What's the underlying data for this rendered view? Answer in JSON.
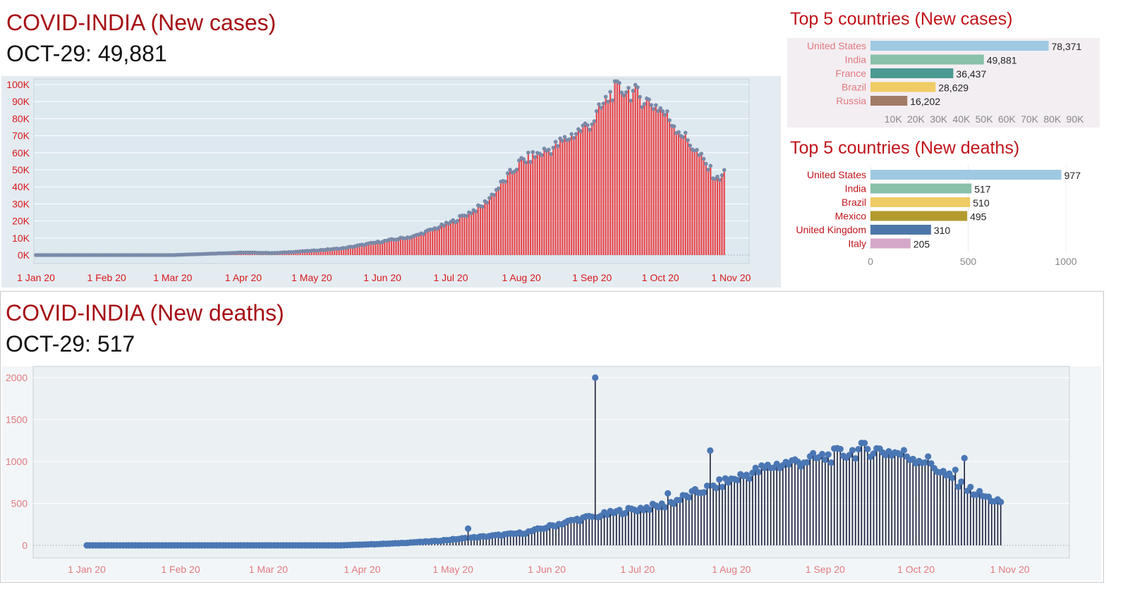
{
  "cases_panel": {
    "title": "COVID-INDIA (New cases)",
    "subtitle": "OCT-29: 49,881"
  },
  "deaths_panel": {
    "title": "COVID-INDIA (New deaths)",
    "subtitle": "OCT-29: 517"
  },
  "top_cases": {
    "title": "Top 5 countries  (New cases)"
  },
  "top_deaths": {
    "title": "Top 5 countries  (New deaths)"
  },
  "colors": {
    "cases_bar": "#e8474c",
    "cases_dot": "#7a8aa8",
    "cases_axis_text": "#d7191c",
    "cases_plot_bg": "#dde8ef",
    "deaths_stem": "#1b1f3b",
    "deaths_dot": "#4a77b4",
    "deaths_axis_text": "#e07a80",
    "deaths_plot_bg": "#ebf0f3"
  },
  "chart_data": [
    {
      "id": "india-new-cases",
      "type": "bar",
      "title": "COVID-INDIA (New cases)",
      "x_start": "2020-01-01",
      "x_end": "2020-10-29",
      "ylim": [
        0,
        100000
      ],
      "y_ticks": [
        0,
        10000,
        20000,
        30000,
        40000,
        50000,
        60000,
        70000,
        80000,
        90000,
        100000
      ],
      "y_tick_labels": [
        "0K",
        "10K",
        "20K",
        "30K",
        "40K",
        "50K",
        "60K",
        "70K",
        "80K",
        "90K",
        "100K"
      ],
      "x_ticks": [
        "2020-01-01",
        "2020-02-01",
        "2020-03-01",
        "2020-04-01",
        "2020-05-01",
        "2020-06-01",
        "2020-07-01",
        "2020-08-01",
        "2020-09-01",
        "2020-10-01",
        "2020-11-01"
      ],
      "x_tick_labels": [
        "1 Jan 20",
        "1 Feb 20",
        "1 Mar 20",
        "1 Apr 20",
        "1 May 20",
        "1 Jun 20",
        "1 Jul 20",
        "1 Aug 20",
        "1 Sep 20",
        "1 Oct 20",
        "1 Nov 20"
      ],
      "keypoints": [
        [
          "2020-01-01",
          0
        ],
        [
          "2020-03-01",
          0
        ],
        [
          "2020-04-01",
          1500
        ],
        [
          "2020-04-15",
          1200
        ],
        [
          "2020-05-01",
          2500
        ],
        [
          "2020-05-15",
          4000
        ],
        [
          "2020-06-01",
          8000
        ],
        [
          "2020-06-15",
          11000
        ],
        [
          "2020-07-01",
          19000
        ],
        [
          "2020-07-15",
          29000
        ],
        [
          "2020-08-01",
          55000
        ],
        [
          "2020-08-15",
          63000
        ],
        [
          "2020-09-01",
          78000
        ],
        [
          "2020-09-10",
          96000
        ],
        [
          "2020-09-16",
          97500
        ],
        [
          "2020-10-01",
          86000
        ],
        [
          "2020-10-15",
          64000
        ],
        [
          "2020-10-26",
          44000
        ],
        [
          "2020-10-29",
          49881
        ]
      ]
    },
    {
      "id": "top5-new-cases",
      "type": "bar",
      "orientation": "horizontal",
      "categories": [
        "United States",
        "India",
        "France",
        "Brazil",
        "Russia"
      ],
      "values": [
        78371,
        49881,
        36437,
        28629,
        16202
      ],
      "value_labels": [
        "78,371",
        "49,881",
        "36,437",
        "28,629",
        "16,202"
      ],
      "colors": [
        "#9ec9e2",
        "#88c0a9",
        "#4a9a92",
        "#f0cc64",
        "#a27b66"
      ],
      "xlim": [
        0,
        90000
      ],
      "x_ticks": [
        10000,
        20000,
        30000,
        40000,
        50000,
        60000,
        70000,
        80000,
        90000
      ],
      "x_tick_labels": [
        "10K",
        "20K",
        "30K",
        "40K",
        "50K",
        "60K",
        "70K",
        "80K",
        "90K"
      ]
    },
    {
      "id": "top5-new-deaths",
      "type": "bar",
      "orientation": "horizontal",
      "categories": [
        "United States",
        "India",
        "Brazil",
        "Mexico",
        "United Kingdom",
        "Italy"
      ],
      "values": [
        977,
        517,
        510,
        495,
        310,
        205
      ],
      "value_labels": [
        "977",
        "517",
        "510",
        "495",
        "310",
        "205"
      ],
      "colors": [
        "#9ec9e2",
        "#88c0a9",
        "#f0cc64",
        "#b49b2e",
        "#4d77a8",
        "#d5a8c9"
      ],
      "xlim": [
        0,
        1000
      ],
      "x_ticks": [
        0,
        500,
        1000
      ],
      "x_tick_labels": [
        "0",
        "500",
        "1000"
      ]
    },
    {
      "id": "india-new-deaths",
      "type": "scatter",
      "style": "lollipop",
      "title": "COVID-INDIA (New deaths)",
      "x_start": "2020-01-01",
      "x_end": "2020-10-29",
      "ylim": [
        0,
        2000
      ],
      "y_ticks": [
        0,
        500,
        1000,
        1500,
        2000
      ],
      "y_tick_labels": [
        "0",
        "500",
        "1000",
        "1500",
        "2000"
      ],
      "x_ticks": [
        "2020-01-01",
        "2020-02-01",
        "2020-03-01",
        "2020-04-01",
        "2020-05-01",
        "2020-06-01",
        "2020-07-01",
        "2020-08-01",
        "2020-09-01",
        "2020-10-01",
        "2020-11-01"
      ],
      "x_tick_labels": [
        "1 Jan 20",
        "1 Feb 20",
        "1 Mar 20",
        "1 Apr 20",
        "1 May 20",
        "1 Jun 20",
        "1 Jul 20",
        "1 Aug 20",
        "1 Sep 20",
        "1 Oct 20",
        "1 Nov 20"
      ],
      "keypoints": [
        [
          "2020-01-01",
          0
        ],
        [
          "2020-03-25",
          0
        ],
        [
          "2020-04-10",
          20
        ],
        [
          "2020-04-25",
          50
        ],
        [
          "2020-05-10",
          100
        ],
        [
          "2020-05-25",
          150
        ],
        [
          "2020-06-10",
          300
        ],
        [
          "2020-06-25",
          400
        ],
        [
          "2020-07-10",
          480
        ],
        [
          "2020-07-22",
          650
        ],
        [
          "2020-08-01",
          780
        ],
        [
          "2020-08-15",
          950
        ],
        [
          "2020-09-01",
          1050
        ],
        [
          "2020-09-15",
          1150
        ],
        [
          "2020-09-25",
          1100
        ],
        [
          "2020-10-05",
          1000
        ],
        [
          "2020-10-15",
          720
        ],
        [
          "2020-10-25",
          560
        ],
        [
          "2020-10-29",
          517
        ]
      ],
      "outliers": [
        [
          "2020-05-06",
          200
        ],
        [
          "2020-06-17",
          2000
        ],
        [
          "2020-07-25",
          1130
        ],
        [
          "2020-07-11",
          620
        ],
        [
          "2020-10-17",
          1040
        ],
        [
          "2020-10-14",
          900
        ]
      ]
    }
  ]
}
